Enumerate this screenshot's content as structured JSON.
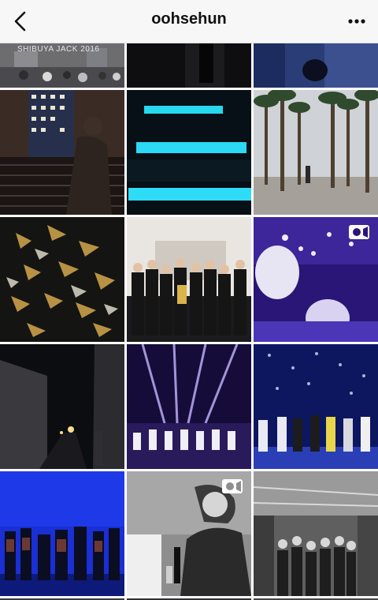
{
  "header": {
    "title": "oohsehun",
    "back_icon": "chevron-left-icon",
    "more_icon": "more-dots-icon"
  },
  "grid": {
    "tiles": [
      {
        "id": "post-1",
        "caption": "SHIBUYA JACK 2016"
      },
      {
        "id": "post-2"
      },
      {
        "id": "post-3"
      },
      {
        "id": "post-4"
      },
      {
        "id": "post-5"
      },
      {
        "id": "post-6"
      },
      {
        "id": "post-7"
      },
      {
        "id": "post-8"
      },
      {
        "id": "post-9",
        "video": true
      },
      {
        "id": "post-10"
      },
      {
        "id": "post-11"
      },
      {
        "id": "post-12"
      },
      {
        "id": "post-13"
      },
      {
        "id": "post-14",
        "video": true
      },
      {
        "id": "post-15"
      }
    ]
  },
  "colors": {
    "header_bg": "#f7f7f7",
    "accent_cyan": "#27d7f0",
    "stage_purple": "#6a3cff"
  }
}
